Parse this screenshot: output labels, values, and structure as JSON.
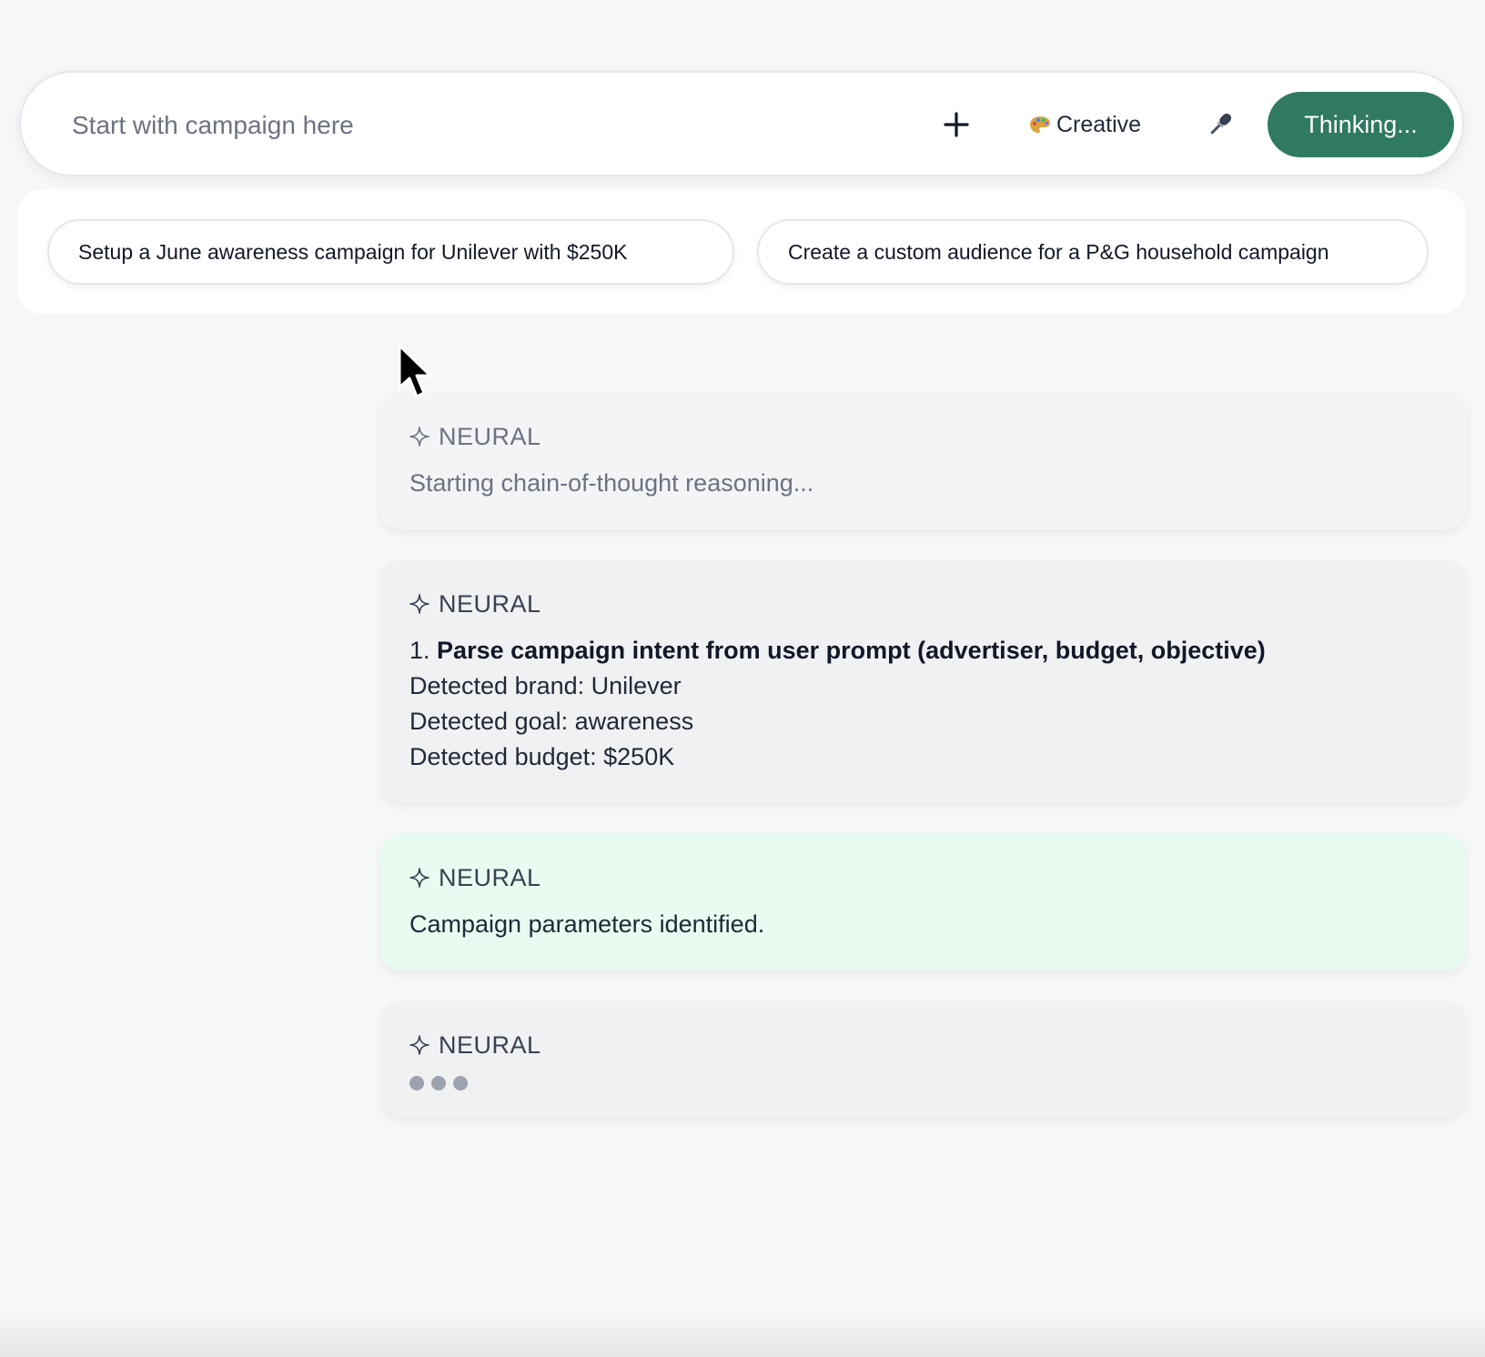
{
  "input_bar": {
    "placeholder": "Start with campaign here",
    "plus_icon": "plus-icon",
    "mode": {
      "icon": "palette-icon",
      "label": "Creative"
    },
    "mic_icon": "microphone-icon",
    "submit_label": "Thinking...",
    "accent_color": "#2f7a61"
  },
  "suggestions": [
    "Setup a June awareness campaign for Unilever with $250K",
    "Create a custom audience for a P&G household campaign"
  ],
  "messages": [
    {
      "sender": "NEURAL",
      "icon": "sparkle-icon",
      "text": "Starting chain-of-thought reasoning..."
    },
    {
      "sender": "NEURAL",
      "icon": "sparkle-icon",
      "step_number": "1.",
      "step_title": "Parse campaign intent from user prompt (advertiser, budget, objective)",
      "lines": [
        "Detected brand: Unilever",
        "Detected goal: awareness",
        "Detected budget: $250K"
      ]
    },
    {
      "sender": "NEURAL",
      "icon": "sparkle-icon",
      "text": "Campaign parameters identified.",
      "background": "#e9faf0"
    },
    {
      "sender": "NEURAL",
      "icon": "sparkle-icon",
      "typing_indicator": "typing-dots"
    }
  ]
}
